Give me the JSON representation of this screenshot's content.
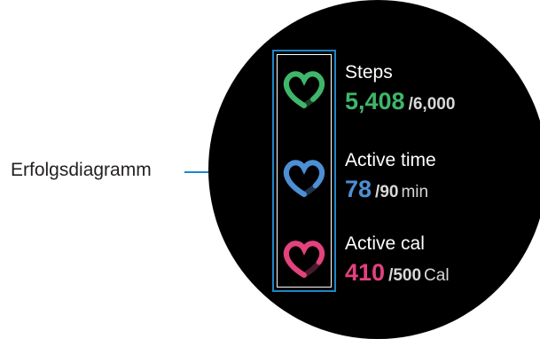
{
  "callout": {
    "label": "Erfolgsdiagramm"
  },
  "metrics": [
    {
      "label": "Steps",
      "current": "5,408",
      "goal": "/6,000",
      "unit": "",
      "color": "#3fb66a",
      "track": "#1b3f26",
      "progress": 0.9
    },
    {
      "label": "Active time",
      "current": "78",
      "goal": "/90",
      "unit": "min",
      "color": "#4d8fd4",
      "track": "#1f334d",
      "progress": 0.87
    },
    {
      "label": "Active cal",
      "current": "410",
      "goal": "/500",
      "unit": "Cal",
      "color": "#e2427d",
      "track": "#4a1a2c",
      "progress": 0.82
    }
  ],
  "icons": {
    "metric_icon": "heart-ring-icon"
  },
  "colors": {
    "callout_accent": "#1f86c7",
    "watch_background": "#000000"
  }
}
